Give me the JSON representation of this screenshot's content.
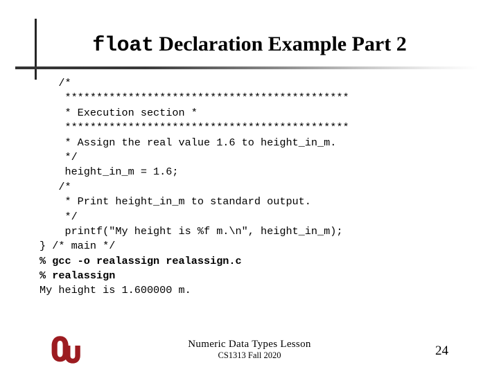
{
  "slide": {
    "title": {
      "mono_part": "float",
      "serif_part": " Declaration Example Part 2"
    },
    "code_lines": [
      {
        "text": "   /*",
        "bold": false
      },
      {
        "text": "    *********************************************",
        "bold": false
      },
      {
        "text": "    * Execution section *",
        "bold": false
      },
      {
        "text": "    *********************************************",
        "bold": false
      },
      {
        "text": "    * Assign the real value 1.6 to height_in_m.",
        "bold": false
      },
      {
        "text": "    */",
        "bold": false
      },
      {
        "text": "    height_in_m = 1.6;",
        "bold": false
      },
      {
        "text": "   /*",
        "bold": false
      },
      {
        "text": "    * Print height_in_m to standard output.",
        "bold": false
      },
      {
        "text": "    */",
        "bold": false
      },
      {
        "text": "    printf(\"My height is %f m.\\n\", height_in_m);",
        "bold": false
      },
      {
        "text": "} /* main */",
        "bold": false
      },
      {
        "text": "% gcc -o realassign realassign.c",
        "bold": true
      },
      {
        "text": "% realassign",
        "bold": true
      },
      {
        "text": "My height is 1.600000 m.",
        "bold": false
      }
    ],
    "footer": {
      "lesson": "Numeric Data Types Lesson",
      "course": "CS1313 Fall 2020",
      "page_number": "24"
    },
    "logo": {
      "name": "ou-logo",
      "color": "#9C1B20"
    },
    "colors": {
      "text": "#000000",
      "rule": "#333333",
      "background": "#FFFFFF"
    }
  }
}
